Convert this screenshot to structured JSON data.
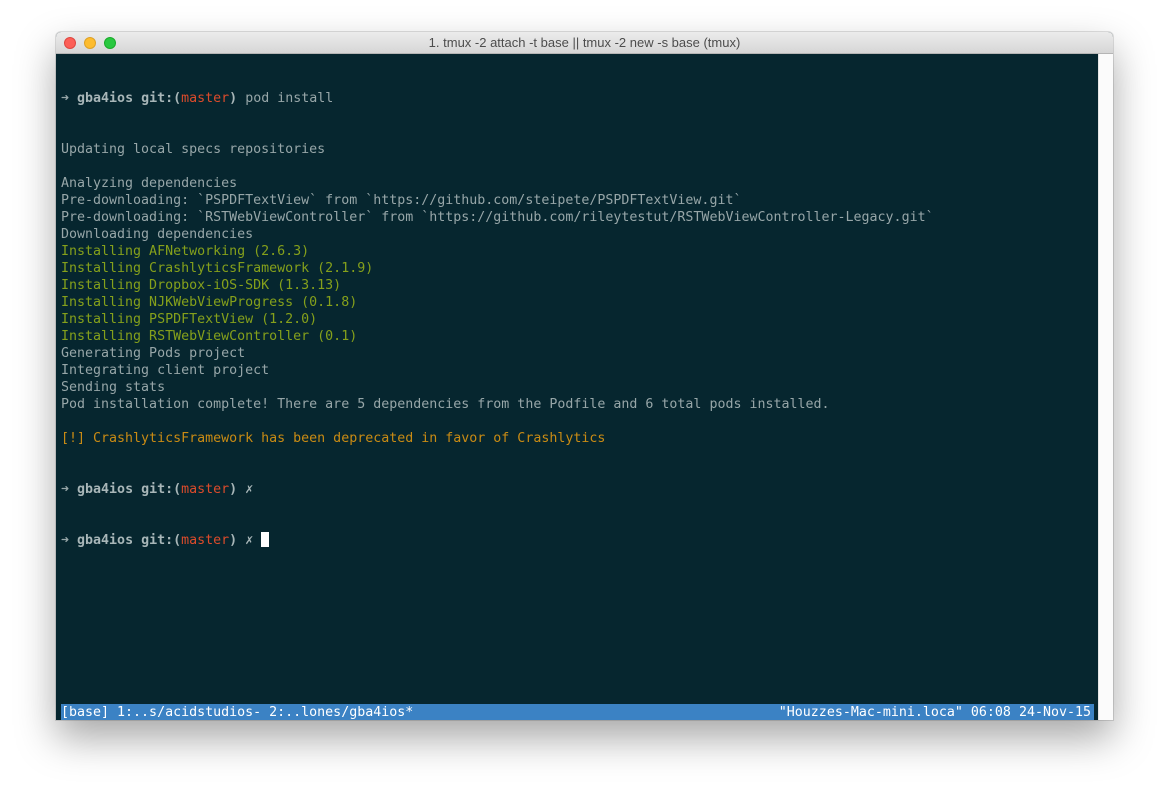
{
  "window": {
    "title": "1. tmux -2 attach -t base || tmux -2 new -s base (tmux)"
  },
  "prompt": {
    "arrow": "➜",
    "host": "gba4ios",
    "git_prefix": " git:(",
    "branch": "master",
    "git_suffix": ")",
    "dirty_mark": "✗"
  },
  "terminal": {
    "command": "pod install",
    "lines": [
      {
        "text": "Updating local specs repositories",
        "style": "normal"
      },
      {
        "text": "",
        "style": "normal"
      },
      {
        "text": "Analyzing dependencies",
        "style": "normal"
      },
      {
        "text": "Pre-downloading: `PSPDFTextView` from `https://github.com/steipete/PSPDFTextView.git`",
        "style": "normal"
      },
      {
        "text": "Pre-downloading: `RSTWebViewController` from `https://github.com/rileytestut/RSTWebViewController-Legacy.git`",
        "style": "normal"
      },
      {
        "text": "Downloading dependencies",
        "style": "normal"
      },
      {
        "text": "Installing AFNetworking (2.6.3)",
        "style": "green"
      },
      {
        "text": "Installing CrashlyticsFramework (2.1.9)",
        "style": "green"
      },
      {
        "text": "Installing Dropbox-iOS-SDK (1.3.13)",
        "style": "green"
      },
      {
        "text": "Installing NJKWebViewProgress (0.1.8)",
        "style": "green"
      },
      {
        "text": "Installing PSPDFTextView (1.2.0)",
        "style": "green"
      },
      {
        "text": "Installing RSTWebViewController (0.1)",
        "style": "green"
      },
      {
        "text": "Generating Pods project",
        "style": "normal"
      },
      {
        "text": "Integrating client project",
        "style": "normal"
      },
      {
        "text": "Sending stats",
        "style": "normal"
      },
      {
        "text": "Pod installation complete! There are 5 dependencies from the Podfile and 6 total pods installed.",
        "style": "normal"
      },
      {
        "text": "",
        "style": "normal"
      },
      {
        "text": "[!] CrashlyticsFramework has been deprecated in favor of Crashlytics",
        "style": "orange"
      }
    ]
  },
  "tmux_status": {
    "left": "[base] 1:..s/acidstudios- 2:..lones/gba4ios*",
    "right": "\"Houzzes-Mac-mini.loca\" 06:08 24-Nov-15"
  },
  "colors": {
    "background": "#06262f",
    "text": "#97a6a8",
    "branch": "#dc4b2b",
    "success": "#85a01b",
    "warning": "#c98b14",
    "status_bar": "#3b82c4"
  }
}
